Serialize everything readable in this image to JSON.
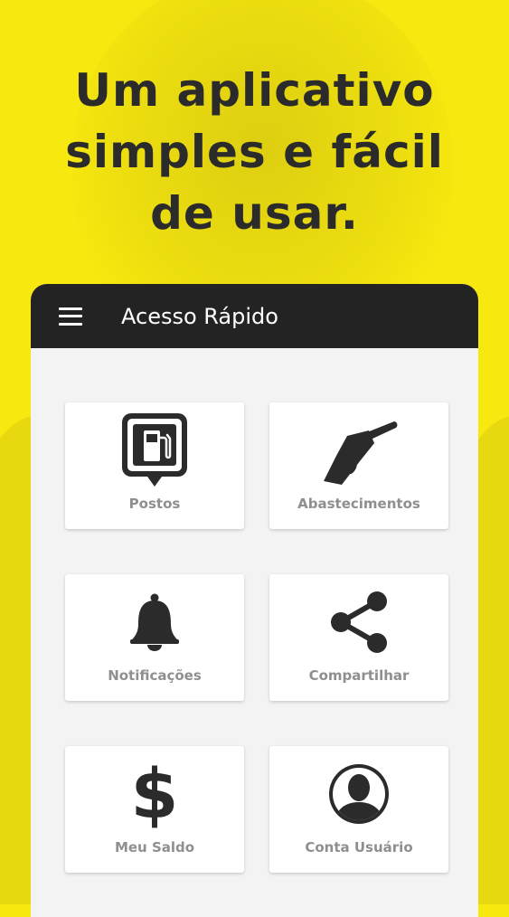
{
  "promo": {
    "headline_line1": "Um aplicativo",
    "headline_line2": "simples e fácil",
    "headline_line3": "de usar."
  },
  "appbar": {
    "menu_icon": "hamburger-menu-icon",
    "title": "Acesso Rápido"
  },
  "tiles": [
    {
      "label": "Postos",
      "icon": "gas-station-pin-icon"
    },
    {
      "label": "Abastecimentos",
      "icon": "fuel-nozzle-icon"
    },
    {
      "label": "Notificações",
      "icon": "bell-icon"
    },
    {
      "label": "Compartilhar",
      "icon": "share-icon"
    },
    {
      "label": "Meu Saldo",
      "icon": "dollar-sign-icon"
    },
    {
      "label": "Conta Usuário",
      "icon": "user-account-icon"
    }
  ],
  "colors": {
    "background": "#f7e80f",
    "appbar": "#232323",
    "icon": "#2b2b2b",
    "label": "#8f8f8f"
  }
}
